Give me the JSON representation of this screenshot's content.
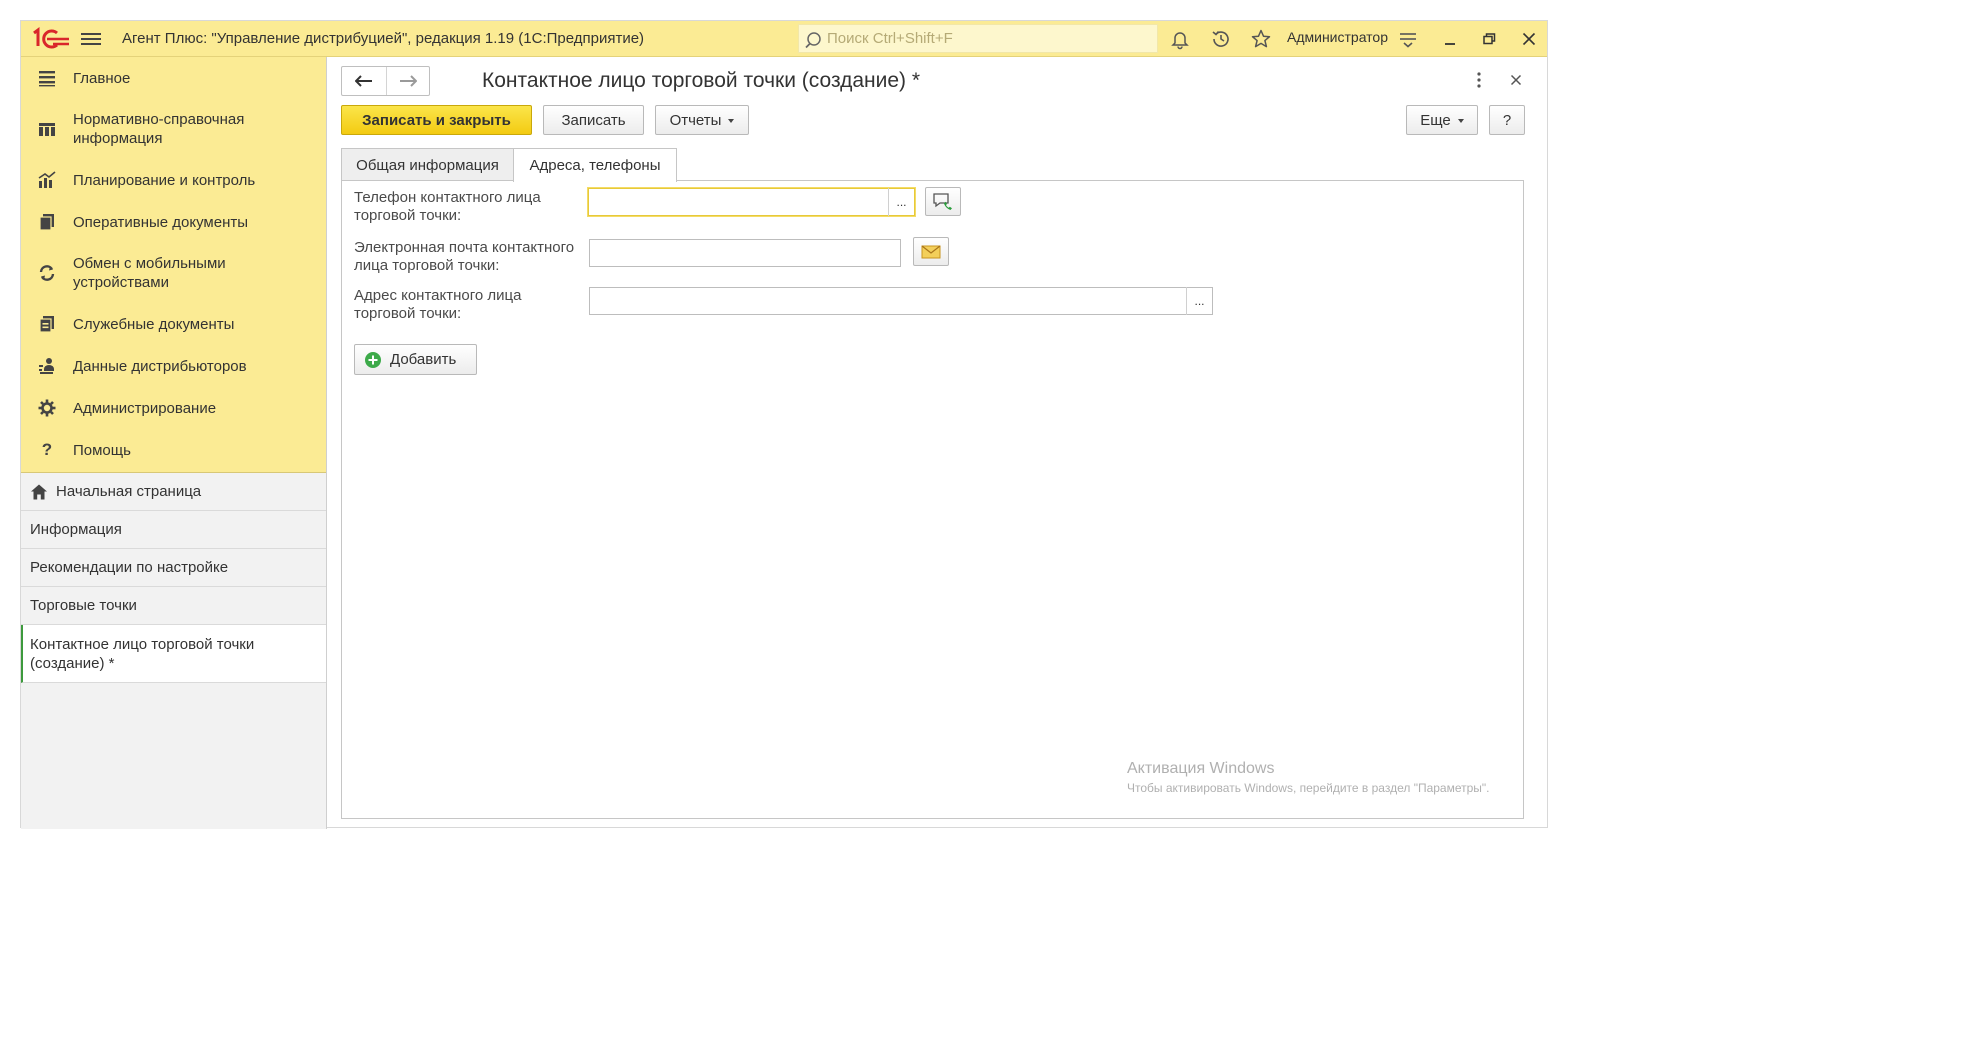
{
  "titlebar": {
    "app_title": "Агент Плюс: \"Управление дистрибуцией\", редакция 1.19  (1С:Предприятие)",
    "search_placeholder": "Поиск Ctrl+Shift+F",
    "user": "Администратор",
    "accent_color": "#fbeb94"
  },
  "sidebar": {
    "sections": [
      {
        "label": "Главное",
        "icon": "list-icon"
      },
      {
        "label": "Нормативно-справочная информация",
        "icon": "catalog-icon"
      },
      {
        "label": "Планирование и контроль",
        "icon": "chart-icon"
      },
      {
        "label": "Оперативные документы",
        "icon": "documents-icon"
      },
      {
        "label": "Обмен с мобильными устройствами",
        "icon": "sync-icon"
      },
      {
        "label": "Служебные документы",
        "icon": "service-docs-icon"
      },
      {
        "label": "Данные дистрибьюторов",
        "icon": "distributors-icon"
      },
      {
        "label": "Администрирование",
        "icon": "gear-icon"
      },
      {
        "label": "Помощь",
        "icon": "help-icon"
      }
    ],
    "open_windows": [
      {
        "label": "Начальная страница",
        "icon": "home-icon"
      },
      {
        "label": "Информация"
      },
      {
        "label": "Рекомендации по настройке"
      },
      {
        "label": "Торговые точки"
      },
      {
        "label": "Контактное лицо торговой точки (создание) *",
        "active": true
      }
    ]
  },
  "form": {
    "title": "Контактное лицо торговой точки (создание) *",
    "toolbar": {
      "save_close": "Записать и закрыть",
      "save": "Записать",
      "reports": "Отчеты",
      "more": "Еще",
      "help": "?"
    },
    "tabs": [
      {
        "label": "Общая информация",
        "active": false
      },
      {
        "label": "Адреса, телефоны",
        "active": true
      }
    ],
    "fields": {
      "phone": {
        "label": "Телефон контактного лица торговой точки:",
        "value": ""
      },
      "email": {
        "label": "Электронная почта контактного лица торговой точки:",
        "value": ""
      },
      "address": {
        "label": "Адрес контактного лица торговой точки:",
        "value": ""
      }
    },
    "choose_glyph": "...",
    "add_button": "Добавить"
  },
  "watermark": {
    "line1": "Активация Windows",
    "line2": "Чтобы активировать Windows, перейдите в раздел \"Параметры\"."
  }
}
